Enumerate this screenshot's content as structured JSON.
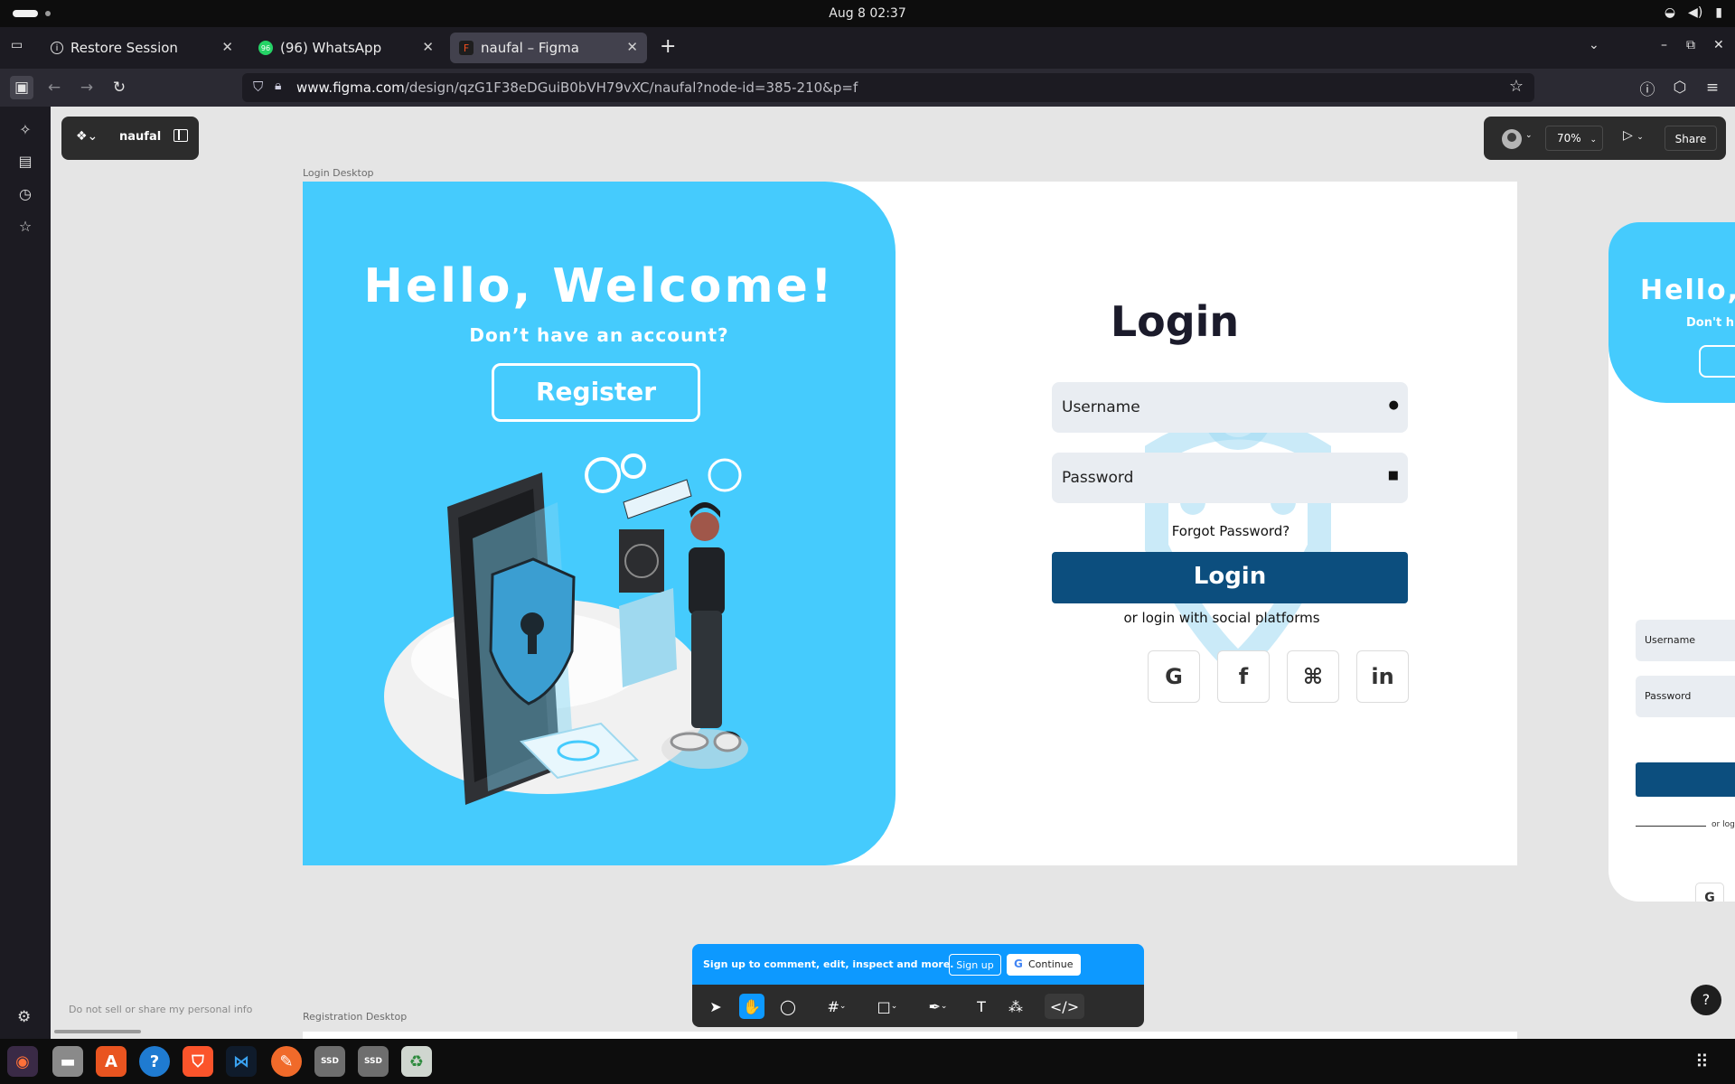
{
  "system": {
    "clock": "Aug 8  02:37"
  },
  "browser": {
    "tabs": [
      {
        "label": "Restore Session"
      },
      {
        "label": "(96) WhatsApp"
      },
      {
        "label": "naufal – Figma"
      }
    ],
    "url_domain": "www.figma.com",
    "url_path": "/design/qzG1F38eDGuiB0bVH79vXC/naufal?node-id=385-210&p=f"
  },
  "figma": {
    "file_name": "naufal",
    "zoom": "70%",
    "share_label": "Share",
    "frame_label": "Login Desktop",
    "frame2_label": "Registration Desktop",
    "left_panel": {
      "title": "Hello, Welcome!",
      "subtitle": "Don’t have an account?",
      "register": "Register"
    },
    "login": {
      "title": "Login",
      "username_placeholder": "Username",
      "password_placeholder": "Password",
      "forgot": "Forgot Password?",
      "button": "Login",
      "social_text": "or login with social platforms",
      "social": [
        "G",
        "f",
        "⌘",
        "in"
      ]
    },
    "frame_right": {
      "title": "Hello,",
      "subtitle": "Don't h",
      "username": "Username",
      "password": "Password",
      "or_login": "or logi",
      "google": "G"
    },
    "banner": {
      "message": "Sign up to comment, edit, inspect and more.",
      "signup": "Sign up",
      "continue": "Continue"
    },
    "footer_link": "Do not sell or share my personal info",
    "help": "?"
  },
  "colors": {
    "accent_blue": "#45cbfd",
    "login_button": "#0c4e7e",
    "figma_blue": "#0d99ff"
  }
}
